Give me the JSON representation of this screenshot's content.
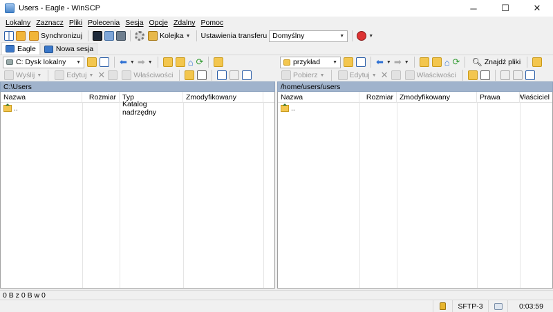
{
  "window": {
    "title": "Users - Eagle - WinSCP"
  },
  "menu": [
    "Lokalny",
    "Zaznacz",
    "Pliki",
    "Polecenia",
    "Sesja",
    "Opcje",
    "Zdalny",
    "Pomoc"
  ],
  "toolbar": {
    "sync_label": "Synchronizuj",
    "queue_label": "Kolejka",
    "transfer_settings_label": "Ustawienia transferu",
    "transfer_preset": "Domyślny"
  },
  "tabs": [
    {
      "label": "Eagle",
      "active": true
    },
    {
      "label": "Nowa sesja",
      "active": false
    }
  ],
  "local": {
    "drive": "C: Dysk lokalny",
    "send_label": "Wyślij",
    "edit_label": "Edytuj",
    "properties_label": "Właściwości",
    "path": "C:\\Users",
    "columns": [
      "Nazwa",
      "Rozmiar",
      "Typ",
      "Zmodyfikowany"
    ],
    "rows": [
      {
        "name": "..",
        "size": "",
        "type": "Katalog nadrzędny",
        "modified": ""
      }
    ]
  },
  "remote": {
    "folder": "przykład",
    "download_label": "Pobierz",
    "edit_label": "Edytuj",
    "properties_label": "Właściwości",
    "find_label": "Znajdź pliki",
    "path": "/home/users/users",
    "columns": [
      "Nazwa",
      "Rozmiar",
      "Zmodyfikowany",
      "Prawa",
      "Właściciel"
    ],
    "rows": [
      {
        "name": "..",
        "size": "",
        "modified": "",
        "rights": "",
        "owner": ""
      }
    ]
  },
  "status": {
    "selection": "0 B z 0 B w 0",
    "protocol": "SFTP-3",
    "time": "0:03:59"
  },
  "colors": {
    "path_bar": "#a0b3cc",
    "folder": "#f3c64e"
  }
}
